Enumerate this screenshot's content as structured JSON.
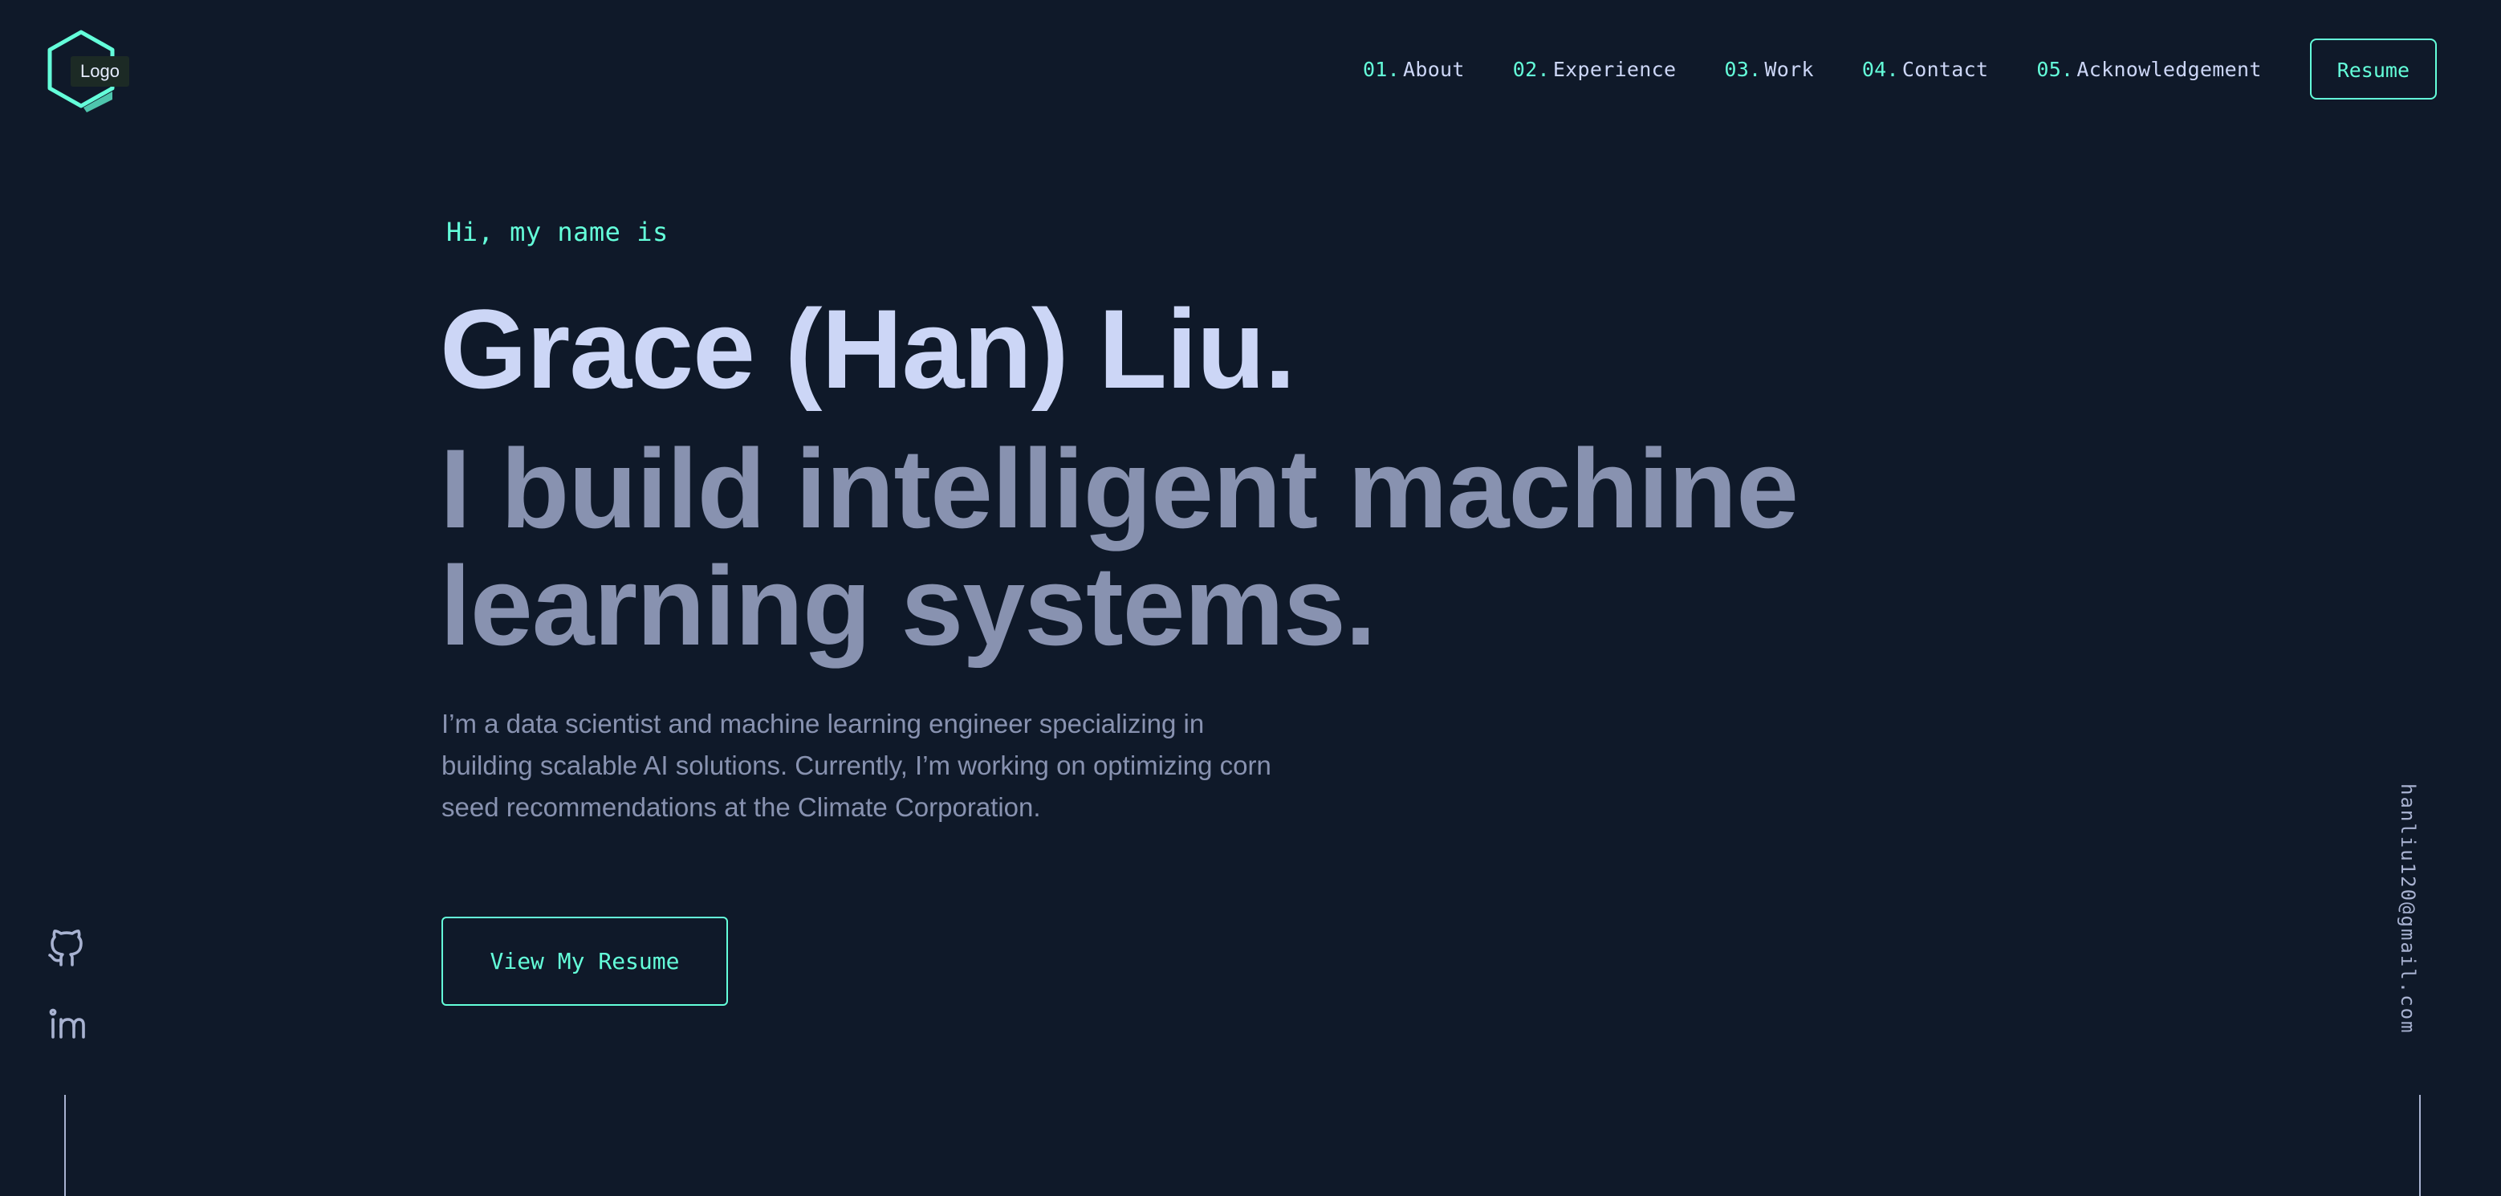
{
  "header": {
    "logo_tooltip": "Logo",
    "logo_icon": "hexagon-logo-icon",
    "nav": [
      {
        "num": "01.",
        "label": "About"
      },
      {
        "num": "02.",
        "label": "Experience"
      },
      {
        "num": "03.",
        "label": "Work"
      },
      {
        "num": "04.",
        "label": "Contact"
      },
      {
        "num": "05.",
        "label": "Acknowledgement"
      }
    ],
    "resume_label": "Resume"
  },
  "hero": {
    "greeting": "Hi, my name is",
    "name": "Grace (Han) Liu.",
    "tagline": "I build intelligent machine learning systems.",
    "intro": "I’m a data scientist and machine learning engineer specializing in building scalable AI solutions. Currently, I’m working on optimizing corn seed recommendations at the Climate Corporation.",
    "cta_label": "View My Resume"
  },
  "social": {
    "icons": [
      "github-icon",
      "linkedin-icon"
    ]
  },
  "side": {
    "email": "hanliu120@gmail.com"
  },
  "colors": {
    "background": "#0f1929",
    "accent": "#64ffda",
    "heading": "#ccd6f6",
    "muted": "#8892b0"
  }
}
